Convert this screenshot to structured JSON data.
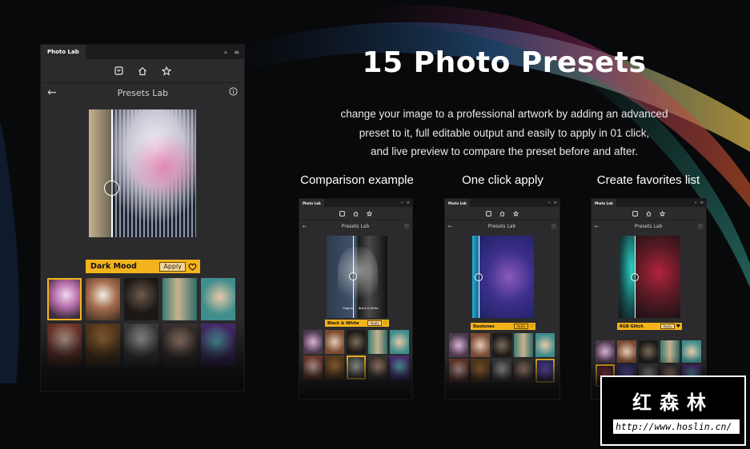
{
  "headline": "15 Photo Presets",
  "description": [
    "change your image to a professional artwork by adding an advanced",
    "preset to it, full editable output and easily to apply in 01 click,",
    "and live preview to compare the preset before and after."
  ],
  "captions": [
    "Comparison example",
    "One click apply",
    "Create favorites list"
  ],
  "panel": {
    "tab_label": "Photo Lab",
    "collapse_glyph": "»",
    "title": "Presets Lab",
    "apply_label": "Apply"
  },
  "main_panel": {
    "preset_name": "Dark Mood"
  },
  "small_panels": [
    {
      "preset_name": "Black & White",
      "before_label": "Original",
      "after_label": "Black & White"
    },
    {
      "preset_name": "Duotones"
    },
    {
      "preset_name": "RGB Glitch"
    }
  ],
  "watermark": {
    "text_cn": "红森林",
    "url": "http://www.hoslin.cn/"
  },
  "colors": {
    "accent": "#f3b31c",
    "panel_bg": "#2b2b2d",
    "page_bg": "#08090b"
  }
}
